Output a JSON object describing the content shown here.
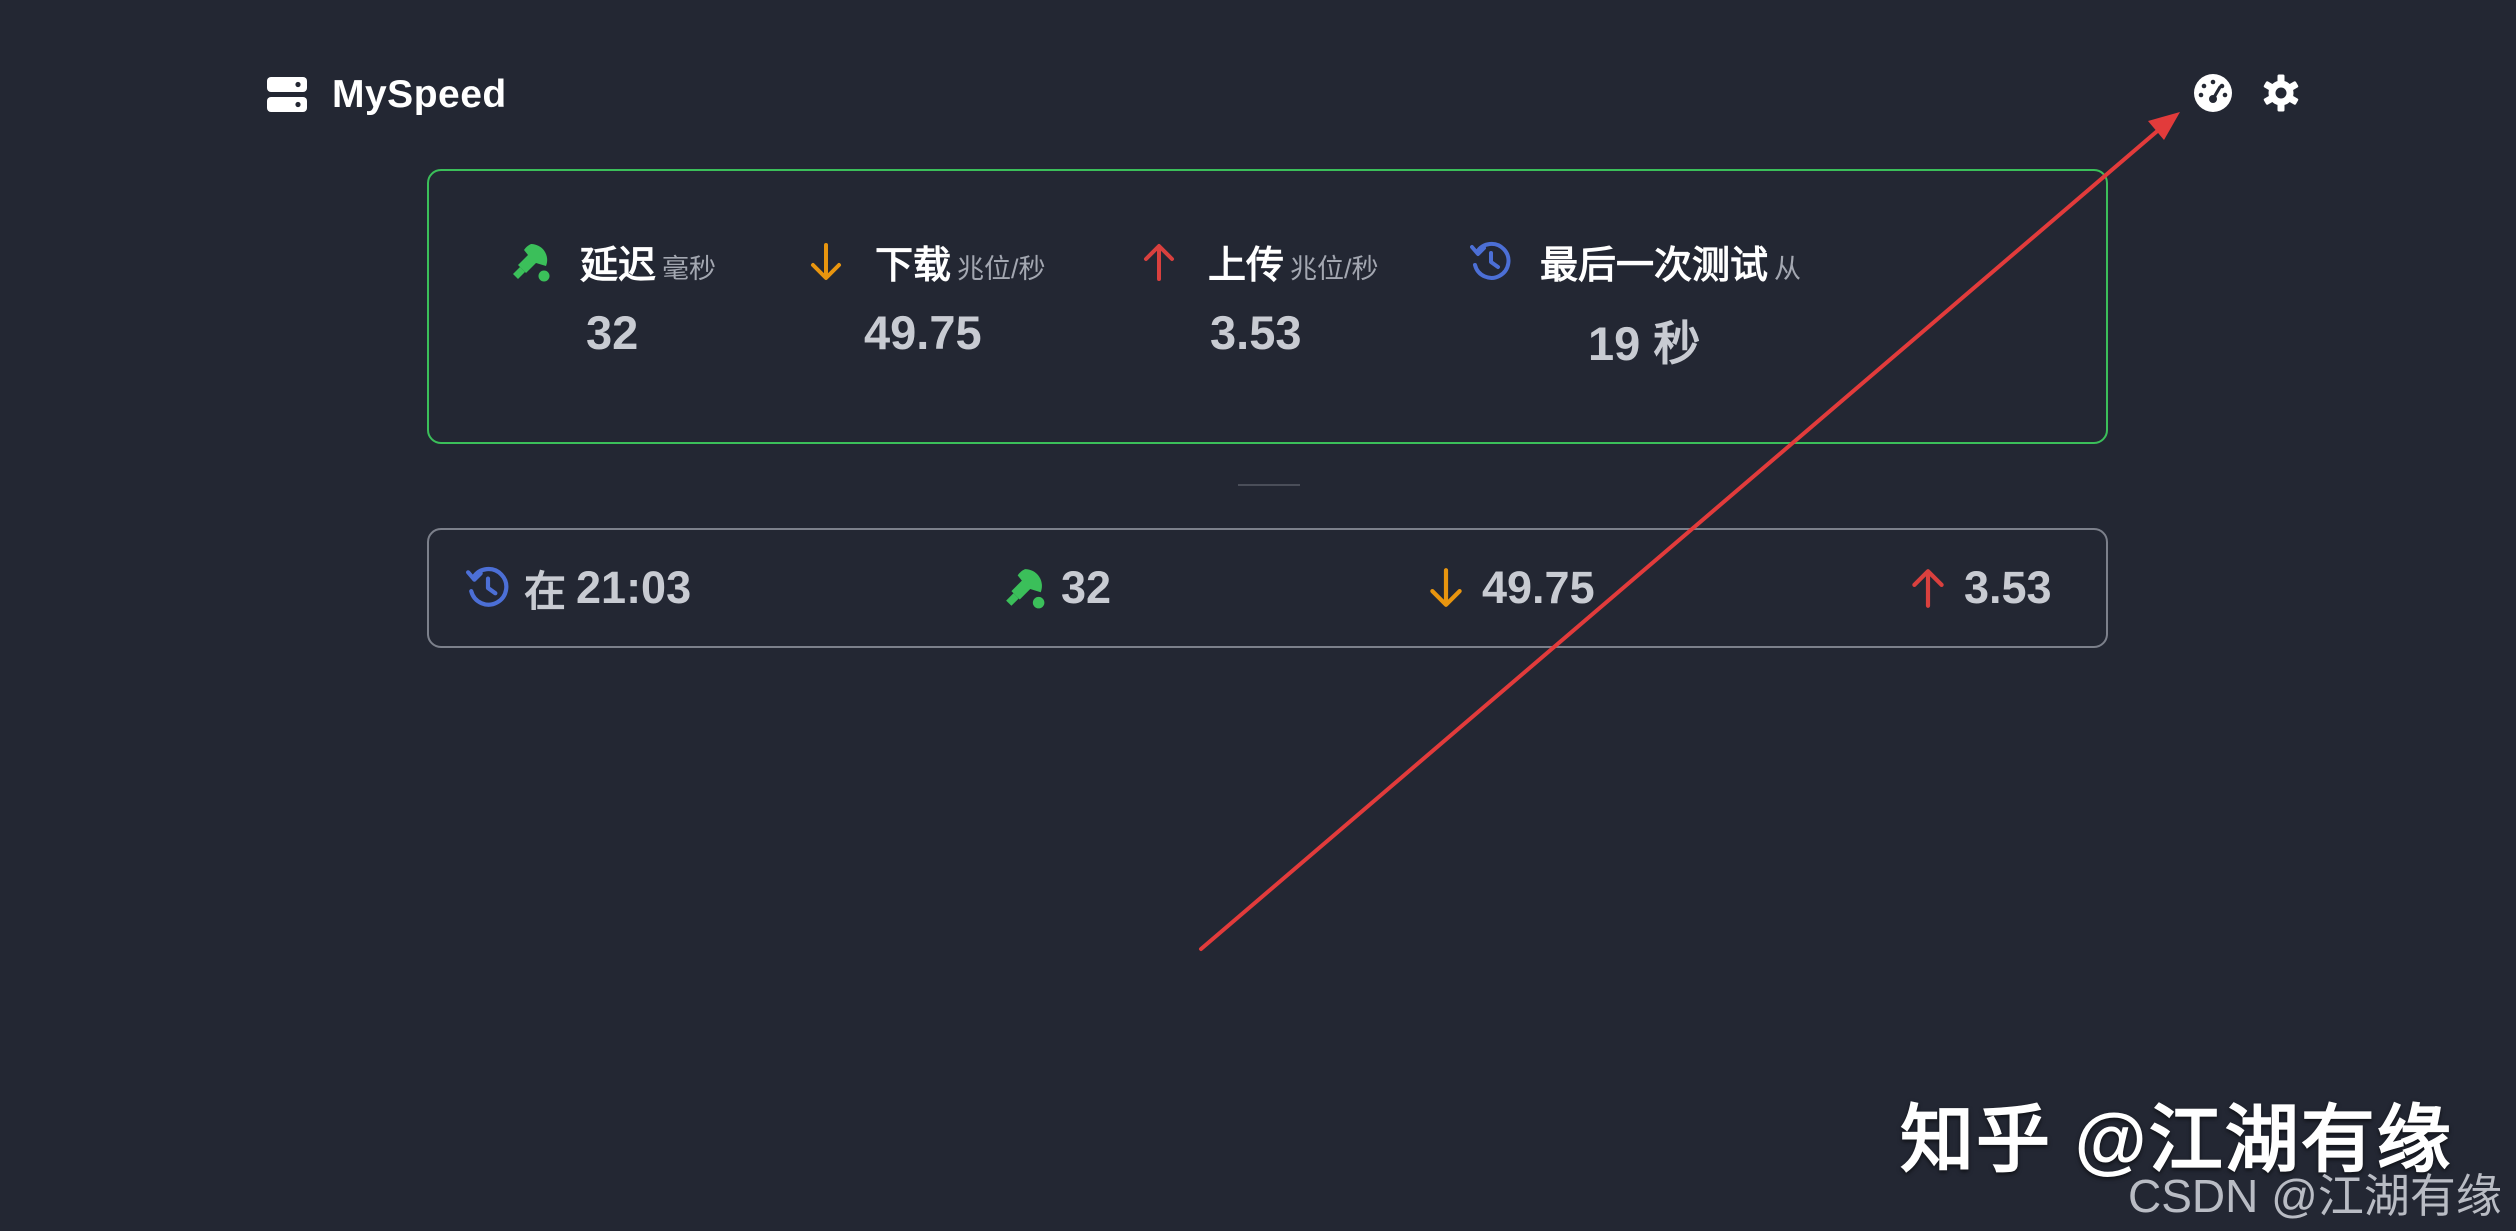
{
  "header": {
    "app_title": "MySpeed",
    "logo_icon": "server-icon",
    "actions": [
      {
        "name": "speedometer-icon"
      },
      {
        "name": "gear-icon"
      }
    ]
  },
  "stats": {
    "ping": {
      "label": "延迟",
      "unit": "毫秒",
      "value": "32",
      "icon": "ping-pong-icon",
      "color": "#3bbf5a"
    },
    "download": {
      "label": "下载",
      "unit": "兆位/秒",
      "value": "49.75",
      "icon": "arrow-down-icon",
      "color": "#e8950f"
    },
    "upload": {
      "label": "上传",
      "unit": "兆位/秒",
      "value": "3.53",
      "icon": "arrow-up-icon",
      "color": "#d9403e"
    },
    "last_test": {
      "label": "最后一次测试",
      "unit": "从",
      "value": "19 秒",
      "icon": "history-icon",
      "color": "#4c6fd6"
    }
  },
  "history": [
    {
      "time_prefix": "在",
      "time": "21:03",
      "ping": "32",
      "download": "49.75",
      "upload": "3.53"
    }
  ],
  "watermark": {
    "main": "知乎 @江湖有缘",
    "small": "CSDN @江湖有缘"
  }
}
